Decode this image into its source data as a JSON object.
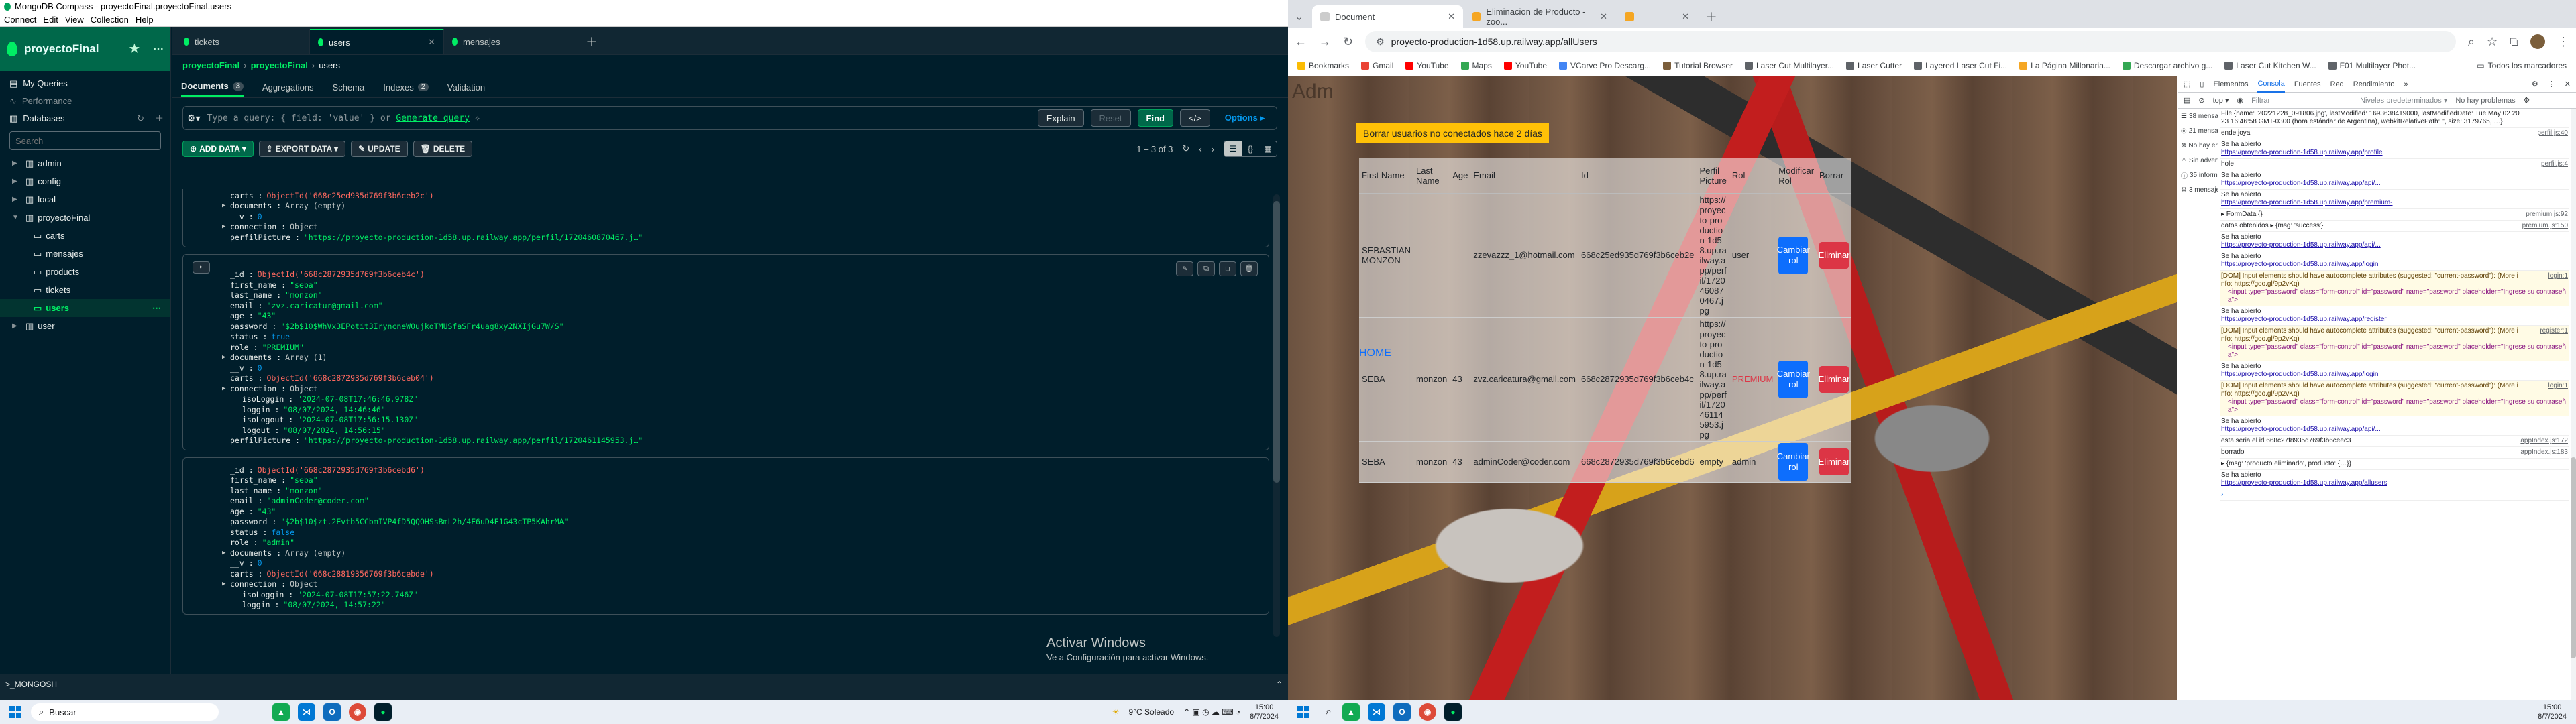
{
  "compass": {
    "window_title": "MongoDB Compass - proyectoFinal.proyectoFinal.users",
    "menu": [
      "Connect",
      "Edit",
      "View",
      "Collection",
      "Help"
    ],
    "connection_name": "proyectoFinal",
    "sidebar_links": [
      "My Queries",
      "Performance"
    ],
    "databases_label": "Databases",
    "search_placeholder": "Search",
    "databases": [
      "admin",
      "config",
      "local",
      "proyectoFinal"
    ],
    "collections": [
      "carts",
      "mensajes",
      "products",
      "tickets",
      "users"
    ],
    "extra_db": "user",
    "tabs": [
      "tickets",
      "users",
      "mensajes"
    ],
    "breadcrumb": [
      "proyectoFinal",
      "proyectoFinal",
      "users"
    ],
    "subtabs": [
      {
        "label": "Documents",
        "badge": "3"
      },
      {
        "label": "Aggregations",
        "badge": ""
      },
      {
        "label": "Schema",
        "badge": ""
      },
      {
        "label": "Indexes",
        "badge": "2"
      },
      {
        "label": "Validation",
        "badge": ""
      }
    ],
    "query_placeholder": "Type a query: { field: 'value' } or",
    "query_link": "Generate query",
    "buttons": {
      "explain": "Explain",
      "reset": "Reset",
      "find": "Find",
      "options": "Options ▸"
    },
    "toolbar": {
      "add": "ADD DATA ▾",
      "export": "EXPORT DATA ▾",
      "update": "UPDATE",
      "delete": "DELETE",
      "count": "1 – 3 of 3"
    },
    "doc0": [
      {
        "k": "carts",
        "v": "ObjectId('668c25ed935d769f3b6ceb2c')",
        "t": "o",
        "i": 0
      },
      {
        "k": "documents",
        "v": "Array (empty)",
        "t": "p",
        "i": 0,
        "e": true
      },
      {
        "k": "__v",
        "v": "0",
        "t": "n",
        "i": 0
      },
      {
        "k": "connection",
        "v": "Object",
        "t": "p",
        "i": 0,
        "e": true
      },
      {
        "k": "perfilPicture",
        "v": "\"https://proyecto-production-1d58.up.railway.app/perfil/1720460870467.j…\"",
        "t": "s",
        "i": 0
      }
    ],
    "doc1": [
      {
        "k": "_id",
        "v": "ObjectId('668c2872935d769f3b6ceb4c')",
        "t": "o",
        "i": 0
      },
      {
        "k": "first_name",
        "v": "\"seba\"",
        "t": "s",
        "i": 0
      },
      {
        "k": "last_name",
        "v": "\"monzon\"",
        "t": "s",
        "i": 0
      },
      {
        "k": "email",
        "v": "\"zvz.caricatur@gmail.com\"",
        "t": "s",
        "i": 0
      },
      {
        "k": "age",
        "v": "\"43\"",
        "t": "s",
        "i": 0
      },
      {
        "k": "password",
        "v": "\"$2b$10$WhVx3EPotit3IryncneW0ujkoTMUSfaSFr4uag8xy2NXIjGu7W/S\"",
        "t": "s",
        "i": 0
      },
      {
        "k": "status",
        "v": "true",
        "t": "n",
        "i": 0
      },
      {
        "k": "role",
        "v": "\"PREMIUM\"",
        "t": "s",
        "i": 0
      },
      {
        "k": "documents",
        "v": "Array (1)",
        "t": "p",
        "i": 0,
        "e": true
      },
      {
        "k": "__v",
        "v": "0",
        "t": "n",
        "i": 0
      },
      {
        "k": "carts",
        "v": "ObjectId('668c2872935d769f3b6ceb04')",
        "t": "o",
        "i": 0
      },
      {
        "k": "connection",
        "v": "Object",
        "t": "p",
        "i": 0,
        "e": true
      },
      {
        "k": "isoLoggin",
        "v": "\"2024-07-08T17:46:46.978Z\"",
        "t": "s",
        "i": 1
      },
      {
        "k": "loggin",
        "v": "\"08/07/2024, 14:46:46\"",
        "t": "s",
        "i": 1
      },
      {
        "k": "isoLogout",
        "v": "\"2024-07-08T17:56:15.130Z\"",
        "t": "s",
        "i": 1
      },
      {
        "k": "logout",
        "v": "\"08/07/2024, 14:56:15\"",
        "t": "s",
        "i": 1
      },
      {
        "k": "perfilPicture",
        "v": "\"https://proyecto-production-1d58.up.railway.app/perfil/1720461145953.j…\"",
        "t": "s",
        "i": 0
      }
    ],
    "doc2": [
      {
        "k": "_id",
        "v": "ObjectId('668c2872935d769f3b6cebd6')",
        "t": "o",
        "i": 0
      },
      {
        "k": "first_name",
        "v": "\"seba\"",
        "t": "s",
        "i": 0
      },
      {
        "k": "last_name",
        "v": "\"monzon\"",
        "t": "s",
        "i": 0
      },
      {
        "k": "email",
        "v": "\"adminCoder@coder.com\"",
        "t": "s",
        "i": 0
      },
      {
        "k": "age",
        "v": "\"43\"",
        "t": "s",
        "i": 0
      },
      {
        "k": "password",
        "v": "\"$2b$10$zt.2Evtb5CCbmIVP4fD5QQOHSsBmL2h/4F6uD4E1G43cTP5KAhrMA\"",
        "t": "s",
        "i": 0
      },
      {
        "k": "status",
        "v": "false",
        "t": "n",
        "i": 0
      },
      {
        "k": "role",
        "v": "\"admin\"",
        "t": "s",
        "i": 0
      },
      {
        "k": "documents",
        "v": "Array (empty)",
        "t": "p",
        "i": 0,
        "e": true
      },
      {
        "k": "__v",
        "v": "0",
        "t": "n",
        "i": 0
      },
      {
        "k": "carts",
        "v": "ObjectId('668c28819356769f3b6cebde')",
        "t": "o",
        "i": 0
      },
      {
        "k": "connection",
        "v": "Object",
        "t": "p",
        "i": 0,
        "e": true
      },
      {
        "k": "isoLoggin",
        "v": "\"2024-07-08T17:57:22.746Z\"",
        "t": "s",
        "i": 1
      },
      {
        "k": "loggin",
        "v": "\"08/07/2024, 14:57:22\"",
        "t": "s",
        "i": 1
      }
    ],
    "activate_title": "Activar Windows",
    "activate_sub": "Ve a Configuración para activar Windows.",
    "shell_label": ">_MONGOSH"
  },
  "chrome": {
    "tabs": [
      "Document",
      "Eliminacion de Producto - zoo...",
      ""
    ],
    "url": "proyecto-production-1d58.up.railway.app/allUsers",
    "bookmarks": [
      "Bookmarks",
      "Gmail",
      "YouTube",
      "Maps",
      "YouTube",
      "VCarve Pro Descarg...",
      "Tutorial Browser",
      "Laser Cut Multilayer...",
      "Laser Cutter",
      "Layered Laser Cut Fi...",
      "La Página Millonaria...",
      "Descargar archivo g...",
      "Laser Cut Kitchen W...",
      "F01 Multilayer Phot..."
    ],
    "all_bookmarks": "Todos los marcadores",
    "page": {
      "watermark": "Adm",
      "delete_inactive_button": "Borrar usuarios no conectados hace 2 días",
      "headers": [
        "First Name",
        "Last Name",
        "Age",
        "Email",
        "Id",
        "Perfil Picture",
        "Rol",
        "Modificar Rol",
        "Borrar"
      ],
      "rows": [
        {
          "first": "SEBASTIAN MONZON",
          "last": "",
          "age": "",
          "email": "zzevazzz_1@hotmail.com",
          "id": "668c25ed935d769f3b6ceb2e",
          "pic": "https://proyecto-production-1d58.up.railway.app/perfil/1720460870467.jpg",
          "rol": "user"
        },
        {
          "first": "SEBA",
          "last": "monzon",
          "age": "43",
          "email": "zvz.caricatura@gmail.com",
          "id": "668c2872935d769f3b6ceb4c",
          "pic": "https://proyecto-production-1d58.up.railway.app/perfil/1720461145953.jpg",
          "rol": "PREMIUM"
        },
        {
          "first": "SEBA",
          "last": "monzon",
          "age": "43",
          "email": "adminCoder@coder.com",
          "id": "668c2872935d769f3b6cebd6",
          "pic": "empty",
          "rol": "admin"
        }
      ],
      "change_role": "Cambiar rol",
      "delete": "Eliminar",
      "home": "HOME"
    },
    "devtools": {
      "tabs": [
        "Elementos",
        "Consola",
        "Fuentes",
        "Red",
        "Rendimiento",
        "»"
      ],
      "context": "top ▾",
      "filter": "Filtrar",
      "levels": "Niveles predeterminados ▾",
      "issues": "No hay problemas",
      "sidebar": [
        "38 mensajes",
        "21 mensaje...",
        "No hay err...",
        "Sin advert...",
        "35 informa...",
        "3 mensajes..."
      ],
      "lines": [
        {
          "t": "File {name: '20221228_091806.jpg', lastModified: 1693638419000, lastModifiedDate: Tue May 02 2023 16:46:58 GMT-0300 (hora estándar de Argentina), webkitRelativePath: '', size: 3179765, …}",
          "s": "",
          "w": false
        },
        {
          "t": "ende joya",
          "s": "perfil.js:40",
          "w": false
        },
        {
          "t": "Se ha abierto",
          "l": "https://proyecto-production-1d58.up.railway.app/profile",
          "s": "",
          "w": false
        },
        {
          "t": "hole",
          "s": "perfil.js:4",
          "w": false
        },
        {
          "t": "Se ha abierto",
          "l": "https://proyecto-production-1d58.up.railway.app/api/...",
          "s": "",
          "w": false
        },
        {
          "t": "Se ha abierto",
          "l": "https://proyecto-production-1d58.up.railway.app/premium-",
          "s": "",
          "w": false
        },
        {
          "t": "▸ FormData {}",
          "s": "premium.js:92",
          "w": false
        },
        {
          "t": "datos obtenidos ▸ {msg: 'success'}",
          "s": "premium.js:150",
          "w": false
        },
        {
          "t": "Se ha abierto",
          "l": "https://proyecto-production-1d58.up.railway.app/api/...",
          "s": "",
          "w": false
        },
        {
          "t": "Se ha abierto",
          "l": "https://proyecto-production-1d58.up.railway.app/login",
          "s": "",
          "w": false
        },
        {
          "t": "[DOM] Input elements should have autocomplete attributes (suggested: \"current-password\"): (More info: https://goo.gl/9p2vKq)",
          "c": "<input type=\"password\" class=\"form-control\" id=\"password\" name=\"password\" placeholder=\"Ingrese su contraseña\">",
          "s": "login:1",
          "w": true
        },
        {
          "t": "Se ha abierto",
          "l": "https://proyecto-production-1d58.up.railway.app/register",
          "s": "",
          "w": false
        },
        {
          "t": "[DOM] Input elements should have autocomplete attributes (suggested: \"current-password\"): (More info: https://goo.gl/9p2vKq)",
          "c": "<input type=\"password\" class=\"form-control\" id=\"password\" name=\"password\" placeholder=\"Ingrese su contraseña\">",
          "s": "register:1",
          "w": true
        },
        {
          "t": "Se ha abierto",
          "l": "https://proyecto-production-1d58.up.railway.app/login",
          "s": "",
          "w": false
        },
        {
          "t": "[DOM] Input elements should have autocomplete attributes (suggested: \"current-password\"): (More info: https://goo.gl/9p2vKq)",
          "c": "<input type=\"password\" class=\"form-control\" id=\"password\" name=\"password\" placeholder=\"Ingrese su contraseña\">",
          "s": "login:1",
          "w": true
        },
        {
          "t": "Se ha abierto",
          "l": "https://proyecto-production-1d58.up.railway.app/api/...",
          "s": "",
          "w": false
        },
        {
          "t": "esta seria el id 668c27f8935d769f3b6ceec3",
          "s": "appIndex.js:172",
          "w": false
        },
        {
          "t": "borrado",
          "s": "appIndex.js:183",
          "w": false
        },
        {
          "t": "▸ {msg: 'producto eliminado', producto: {…}}",
          "s": "",
          "w": false
        },
        {
          "t": "Se ha abierto",
          "l": "https://proyecto-production-1d58.up.railway.app/allusers",
          "s": "",
          "w": false
        }
      ]
    }
  },
  "taskbar": {
    "search": "Buscar",
    "weather": "9°C  Soleado",
    "time": "15:00",
    "date": "8/7/2024"
  }
}
